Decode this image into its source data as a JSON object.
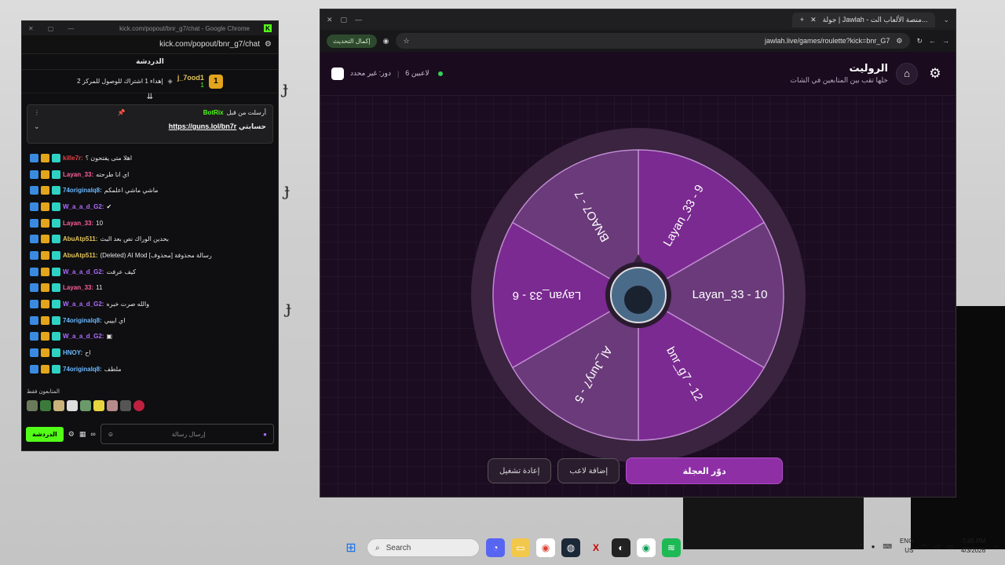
{
  "chat_window": {
    "title": "kick.com/popout/bnr_g7/chat - Google Chrome",
    "url": "kick.com/popout/bnr_g7/chat",
    "header": "الدردشة",
    "top_rank": "1",
    "top_user": "j_7ood1",
    "top_user_count": "1",
    "top_line": "إهداء 1 اشتراك للوصول للمركز 2",
    "pinned": {
      "pinned_by": "أرسلت من قبل",
      "bot_name": "BotRix",
      "prefix": "حسابتي",
      "link": "https://guns.lol/bn7r"
    },
    "messages": [
      {
        "user": "kille7r",
        "text": "اهلا متى يفتحون ؟",
        "color": "#e0404a"
      },
      {
        "user": "Layan_33",
        "text": "اي انا طرحته",
        "color": "#ff5f9a"
      },
      {
        "user": "74originalq8",
        "text": "ماشي ماشي اعلمكم",
        "color": "#6ab8ff"
      },
      {
        "user": "W_a_a_d_G2",
        "text": "✔",
        "color": "#b06cff"
      },
      {
        "user": "Layan_33",
        "text": "10",
        "color": "#ff5f9a"
      },
      {
        "user": "AbuAtp511",
        "text": "بحدين الوراك نص بعد البث",
        "color": "#e2c35a"
      },
      {
        "user": "AbuAtp511",
        "text": "(Deleted) AI Mod [محذوف] رسالة محذوفة",
        "color": "#e2c35a"
      },
      {
        "user": "W_a_a_d_G2",
        "text": "كيف عرفت",
        "color": "#b06cff"
      },
      {
        "user": "Layan_33",
        "text": "11",
        "color": "#ff5f9a"
      },
      {
        "user": "W_a_a_d_G2",
        "text": "والله صرت خبره",
        "color": "#b06cff"
      },
      {
        "user": "74originalq8",
        "text": "اي ايييي",
        "color": "#6ab8ff"
      },
      {
        "user": "W_a_a_d_G2",
        "text": "▣",
        "color": "#b06cff"
      },
      {
        "user": "HNOY",
        "text": "اح",
        "color": "#6ab8ff"
      },
      {
        "user": "74originalq8",
        "text": "ملطف",
        "color": "#6ab8ff"
      }
    ],
    "followers_only": "المتابعون فقط",
    "input_placeholder": "إرسال رسالة",
    "send_label": "الدردشة"
  },
  "game_window": {
    "tab_title": "جولة | Jawlah - منصة الألعاب الت...",
    "url": "jawlah.live/games/roulette?kick=bnr_G7",
    "update_button": "إكمال التحديث",
    "title": "الروليت",
    "subtitle": "خلها تقب بين المتابعين في الشات",
    "player_count": "6 لاعبين",
    "round_status": "دور: غير محدد",
    "wheel_segments": [
      {
        "label": "Layan_33 - 9",
        "color": "#7a2a90"
      },
      {
        "label": "Layan_33 - 10",
        "color": "#6a3a7a"
      },
      {
        "label": "bnr_g7 - 12",
        "color": "#7a2a90"
      },
      {
        "label": "Al_Jury7 - 5",
        "color": "#6a3a7a"
      },
      {
        "label": "Layan_33 - 6",
        "color": "#7a2a90"
      },
      {
        "label": "BNAO7 - 7",
        "color": "#6a3a7a"
      }
    ],
    "buttons": {
      "replay": "إعادة تشغيل",
      "add_player": "إضافة لاعب",
      "spin": "دوّر العجلة"
    }
  },
  "taskbar": {
    "search_placeholder": "Search",
    "lang": "ENG",
    "region": "US",
    "time": "7:45 PM",
    "date": "4/3/2026"
  }
}
